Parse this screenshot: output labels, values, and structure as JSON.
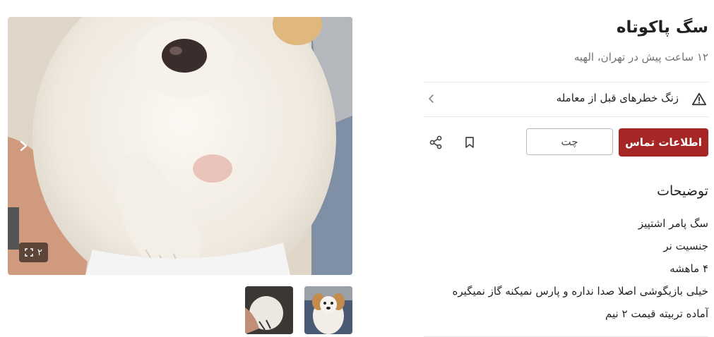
{
  "listing": {
    "title": "سگ پاکوتاه",
    "subtitle": "۱۲ ساعت پیش در تهران، الهیه"
  },
  "warning": {
    "label": "زنگ خطرهای قبل از معامله",
    "icon": "warning-triangle-icon"
  },
  "actions": {
    "contact_label": "اطلاعات تماس",
    "chat_label": "چت",
    "bookmark_icon": "bookmark-icon",
    "share_icon": "share-icon"
  },
  "description": {
    "heading": "توضیحات",
    "lines": [
      "سگ پامر اشتپیز",
      "جنسیت نر",
      "۴ ماهشه",
      "خیلی بازیگوشی اصلا صدا نداره و پارس نمیکنه گاز نمیگیره",
      "آماده تربیته قیمت ۲ نیم"
    ]
  },
  "gallery": {
    "image_count": "۲",
    "next_icon": "chevron-right-icon",
    "expand_icon": "expand-icon",
    "thumbnails": [
      "puppy-photo-1",
      "puppy-photo-2"
    ]
  },
  "colors": {
    "primary": "#a62626",
    "divider": "#e6e6e6",
    "secondary_text": "rgba(0,0,0,0.56)"
  }
}
